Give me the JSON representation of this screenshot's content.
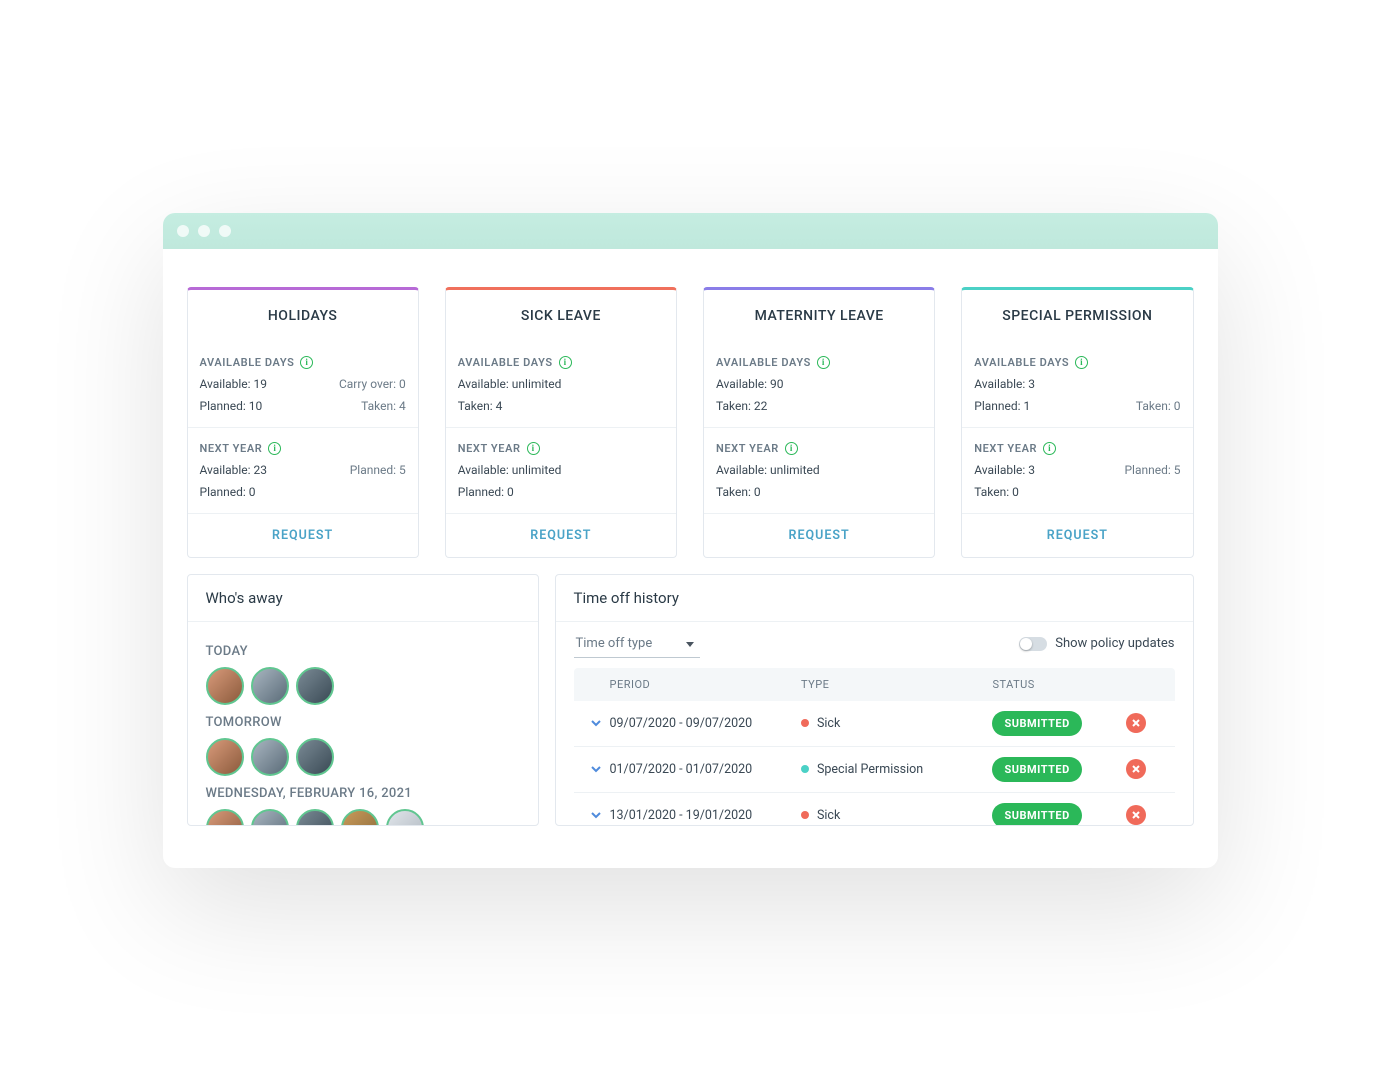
{
  "cards": [
    {
      "title": "HOLIDAYS",
      "accent": "#b76ad6",
      "sec1_head": "AVAILABLE DAYS",
      "s1a": "Available: 19",
      "s1b": "Carry over: 0",
      "s1c": "Planned: 10",
      "s1d": "Taken: 4",
      "sec2_head": "NEXT YEAR",
      "s2a": "Available: 23",
      "s2b": "Planned: 5",
      "s2c": "Planned: 0",
      "request": "REQUEST"
    },
    {
      "title": "SICK LEAVE",
      "accent": "#f0705c",
      "sec1_head": "AVAILABLE DAYS",
      "s1a": "Available: unlimited",
      "s1c": "Taken: 4",
      "sec2_head": "NEXT YEAR",
      "s2a": "Available: unlimited",
      "s2c": "Planned: 0",
      "request": "REQUEST"
    },
    {
      "title": "MATERNITY LEAVE",
      "accent": "#8a7de8",
      "sec1_head": "AVAILABLE DAYS",
      "s1a": "Available: 90",
      "s1c": "Taken: 22",
      "sec2_head": "NEXT YEAR",
      "s2a": "Available: unlimited",
      "s2c": "Taken: 0",
      "request": "REQUEST"
    },
    {
      "title": "SPECIAL PERMISSION",
      "accent": "#4bd1c6",
      "sec1_head": "AVAILABLE DAYS",
      "s1a": "Available: 3",
      "s1c": "Planned: 1",
      "s1d": "Taken: 0",
      "sec2_head": "NEXT YEAR",
      "s2a": "Available: 3",
      "s2b": "Planned: 5",
      "s2c": "Taken: 0",
      "request": "REQUEST"
    }
  ],
  "whos_away": {
    "title": "Who's away",
    "days": [
      {
        "label": "TODAY",
        "count": 3
      },
      {
        "label": "TOMORROW",
        "count": 3
      },
      {
        "label": "WEDNESDAY, FEBRUARY 16, 2021",
        "count": 5
      }
    ]
  },
  "history": {
    "title": "Time off history",
    "type_placeholder": "Time off type",
    "show_updates_label": "Show policy updates",
    "columns": {
      "period": "PERIOD",
      "type": "TYPE",
      "status": "STATUS"
    },
    "rows": [
      {
        "period": "09/07/2020 - 09/07/2020",
        "type": "Sick",
        "type_color": "#f06a5a",
        "status": "SUBMITTED"
      },
      {
        "period": "01/07/2020 - 01/07/2020",
        "type": "Special Permission",
        "type_color": "#4bd1c6",
        "status": "SUBMITTED"
      },
      {
        "period": "13/01/2020 - 19/01/2020",
        "type": "Sick",
        "type_color": "#f06a5a",
        "status": "SUBMITTED"
      }
    ]
  }
}
